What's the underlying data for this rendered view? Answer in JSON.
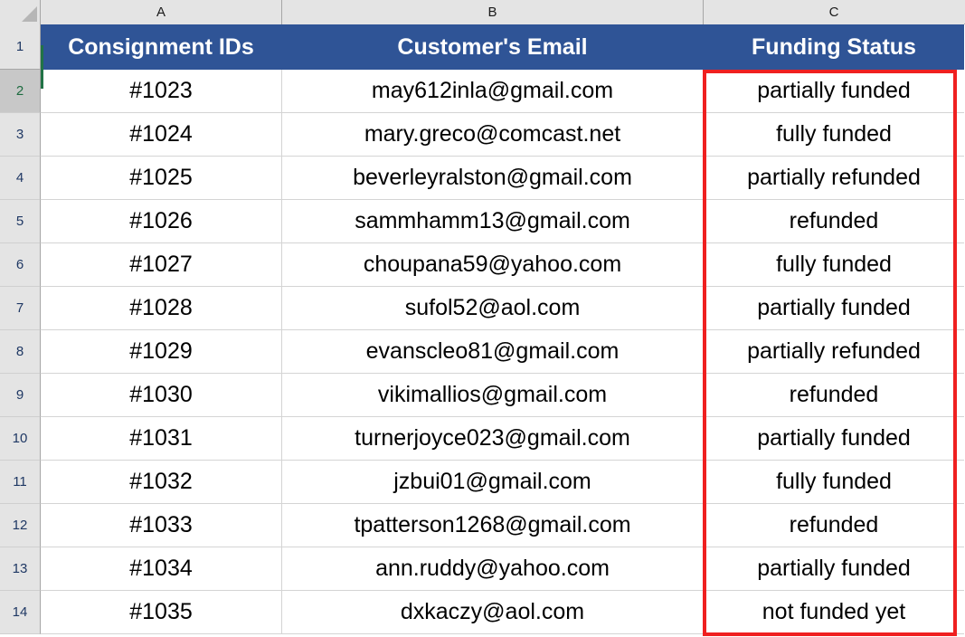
{
  "spreadsheet": {
    "column_letters": [
      "A",
      "B",
      "C"
    ],
    "row_numbers": [
      "1",
      "2",
      "3",
      "4",
      "5",
      "6",
      "7",
      "8",
      "9",
      "10",
      "11",
      "12",
      "13",
      "14"
    ],
    "active_cell": "A2",
    "colors": {
      "header_fill": "#2f5496",
      "header_text": "#ffffff",
      "highlight_border": "#ef2020",
      "active_cell_marker": "#217346",
      "gridline": "#d4d4d4",
      "gutter_fill": "#e4e4e4",
      "row_number_text": "#1f3864",
      "active_row_number_text": "#1d6b3f"
    },
    "table_headers": {
      "a": "Consignment IDs",
      "b": "Customer's Email",
      "c": "Funding Status"
    },
    "rows": [
      {
        "row": "2",
        "consignment_id": "#1023",
        "email": "may612inla@gmail.com",
        "funding_status": "partially funded"
      },
      {
        "row": "3",
        "consignment_id": "#1024",
        "email": "mary.greco@comcast.net",
        "funding_status": "fully funded"
      },
      {
        "row": "4",
        "consignment_id": "#1025",
        "email": "beverleyralston@gmail.com",
        "funding_status": "partially refunded"
      },
      {
        "row": "5",
        "consignment_id": "#1026",
        "email": "sammhamm13@gmail.com",
        "funding_status": "refunded"
      },
      {
        "row": "6",
        "consignment_id": "#1027",
        "email": "choupana59@yahoo.com",
        "funding_status": "fully funded"
      },
      {
        "row": "7",
        "consignment_id": "#1028",
        "email": "sufol52@aol.com",
        "funding_status": "partially funded"
      },
      {
        "row": "8",
        "consignment_id": "#1029",
        "email": "evanscleo81@gmail.com",
        "funding_status": "partially refunded"
      },
      {
        "row": "9",
        "consignment_id": "#1030",
        "email": "vikimallios@gmail.com",
        "funding_status": "refunded"
      },
      {
        "row": "10",
        "consignment_id": "#1031",
        "email": "turnerjoyce023@gmail.com",
        "funding_status": "partially funded"
      },
      {
        "row": "11",
        "consignment_id": "#1032",
        "email": "jzbui01@gmail.com",
        "funding_status": "fully funded"
      },
      {
        "row": "12",
        "consignment_id": "#1033",
        "email": "tpatterson1268@gmail.com",
        "funding_status": "refunded"
      },
      {
        "row": "13",
        "consignment_id": "#1034",
        "email": "ann.ruddy@yahoo.com",
        "funding_status": "partially funded"
      },
      {
        "row": "14",
        "consignment_id": "#1035",
        "email": "dxkaczy@aol.com",
        "funding_status": "not funded yet"
      }
    ]
  }
}
